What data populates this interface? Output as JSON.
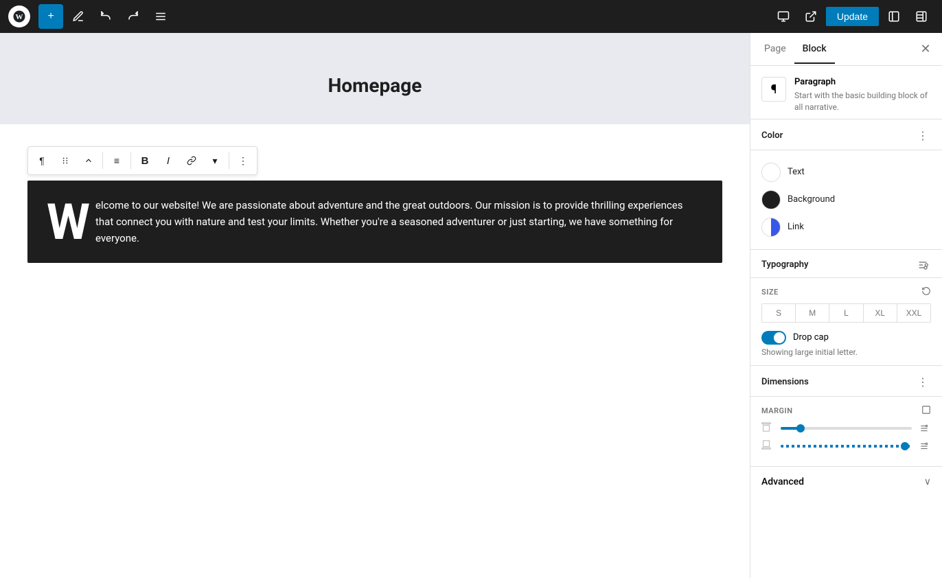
{
  "topbar": {
    "add_label": "+",
    "update_label": "Update"
  },
  "editor": {
    "page_title": "Homepage",
    "paragraph_text": "elcome to our website! We are passionate about adventure and the great outdoors. Our mission is to provide thrilling experiences that connect you with nature and test your limits. Whether you're a seasoned adventurer or just starting, we have something for everyone.",
    "drop_cap_letter": "W"
  },
  "sidebar": {
    "tab_page": "Page",
    "tab_block": "Block",
    "block_name": "Paragraph",
    "block_description": "Start with the basic building block of all narrative.",
    "sections": {
      "color": {
        "title": "Color",
        "text_label": "Text",
        "background_label": "Background",
        "link_label": "Link"
      },
      "typography": {
        "title": "Typography",
        "size_label": "SIZE",
        "sizes": [
          "S",
          "M",
          "L",
          "XL",
          "XXL"
        ],
        "drop_cap_label": "Drop cap",
        "drop_cap_hint": "Showing large initial letter."
      },
      "dimensions": {
        "title": "Dimensions",
        "margin_label": "MARGIN"
      },
      "advanced": {
        "title": "Advanced"
      }
    }
  },
  "toolbar": {
    "paragraph_icon": "¶",
    "bold_label": "B",
    "italic_label": "I",
    "align_icon": "≡",
    "more_icon": "⋮"
  }
}
